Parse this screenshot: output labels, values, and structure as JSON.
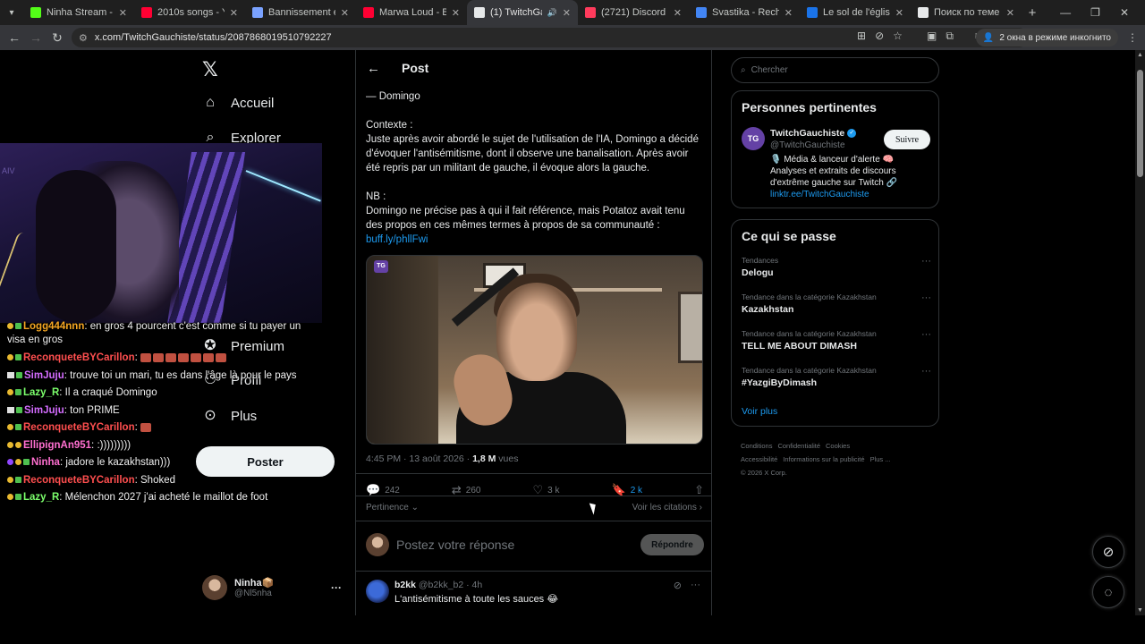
{
  "browser": {
    "tabs": [
      {
        "title": "Ninha Stream - Watc",
        "favicon_color": "#53fc18",
        "active": false
      },
      {
        "title": "2010s songs - YouTu",
        "favicon_color": "#ff0033",
        "active": false
      },
      {
        "title": "Bannissement et exp",
        "favicon_color": "#7aa2ff",
        "active": false
      },
      {
        "title": "Marwa Loud - Bad B",
        "favicon_color": "#ff0033",
        "active": false
      },
      {
        "title": "(1) TwitchGauchi",
        "favicon_color": "#e7e9ea",
        "active": true
      },
      {
        "title": "(2721) Discord | @Ne",
        "favicon_color": "#ff3b5c",
        "active": false
      },
      {
        "title": "Svastika - Recherche",
        "favicon_color": "#4285f4",
        "active": false
      },
      {
        "title": "Le sol de l'église de",
        "favicon_color": "#1a73e8",
        "active": false
      },
      {
        "title": "Поиск по теме «aze",
        "favicon_color": "#e7e9ea",
        "active": false
      }
    ],
    "url": "x.com/TwitchGauchiste/status/2087868019510792227",
    "incognito_label": "2 окна в режиме инкогнито"
  },
  "nav": {
    "items": [
      {
        "label": "Accueil",
        "icon": "home-icon"
      },
      {
        "label": "Explorer",
        "icon": "search-icon"
      },
      {
        "label": "Premium",
        "icon": "x-premium-icon"
      },
      {
        "label": "Profil",
        "icon": "profile-icon"
      },
      {
        "label": "Plus",
        "icon": "more-circle-icon"
      }
    ],
    "post_button": "Poster",
    "account": {
      "name": "Ninha📦",
      "handle": "@Nl5nha"
    }
  },
  "chat": [
    {
      "user": "Logg444nnn",
      "color": "#f5a623",
      "text": "en gros 4 pourcent c'est comme si tu payer un visa en gros"
    },
    {
      "user": "ReconqueteBYCarillon",
      "color": "#ff4f4f",
      "text": ""
    },
    {
      "user": "SimJuju",
      "color": "#d46cff",
      "text": "trouve toi un mari, tu es dans l'âge là pour le pays"
    },
    {
      "user": "Lazy_R",
      "color": "#7cff6c",
      "text": "Il a craqué Domingo"
    },
    {
      "user": "SimJuju",
      "color": "#d46cff",
      "text": "ton PRIME"
    },
    {
      "user": "ReconqueteBYCarillon",
      "color": "#ff4f4f",
      "text": ""
    },
    {
      "user": "EllipignAn951",
      "color": "#ff6fd0",
      "text": ":)))))))))"
    },
    {
      "user": "Ninha",
      "color": "#ff6fd0",
      "text": "jadore le kazakhstan)))"
    },
    {
      "user": "ReconqueteBYCarillon",
      "color": "#ff4f4f",
      "text": "Shoked"
    },
    {
      "user": "Lazy_R",
      "color": "#7cff6c",
      "text": "Mélenchon 2027 j'ai acheté le maillot de foot"
    }
  ],
  "post": {
    "header_title": "Post",
    "signature": "— Domingo",
    "context_label": "Contexte :",
    "context_text": "Juste après avoir abordé le sujet de l'utilisation de l'IA, Domingo a décidé d'évoquer l'antisémitisme, dont il observe une banalisation. Après avoir été repris par un militant de gauche, il évoque alors la gauche.",
    "nb_label": "NB :",
    "nb_text": "Domingo ne précise pas à qui il fait référence, mais Potatoz avait tenu des propos en ces mêmes termes à propos de sa communauté :",
    "link": "buff.ly/phllFwi",
    "media_badge": "TG",
    "time": "4:45 PM · 13 août 2026 · ",
    "views_count": "1,8 M",
    "views_label": " vues",
    "replies": "242",
    "reposts": "260",
    "likes": "3 k",
    "bookmarks": "2 k",
    "sort_label": "Pertinence",
    "quotes_label": "Voir les citations",
    "reply_placeholder": "Postez votre réponse",
    "reply_button": "Répondre"
  },
  "comment": {
    "name": "b2kk",
    "handle": "@b2kk_b2 · 4h",
    "text": "L'antisémitisme à toute les sauces 😂"
  },
  "sidebar": {
    "search_placeholder": "Chercher",
    "relevant_title": "Personnes pertinentes",
    "account": {
      "avatar": "TG",
      "name": "TwitchGauchiste",
      "handle": "@TwitchGauchiste",
      "follow": "Suivre",
      "bio": "🎙️ Média & lanceur d'alerte 🧠 Analyses et extraits de discours d'extrême gauche sur Twitch 🔗",
      "link": "linktr.ee/TwitchGauchiste"
    },
    "trends_title": "Ce qui se passe",
    "trends": [
      {
        "context": "Tendances",
        "name": "Delogu"
      },
      {
        "context": "Tendance dans la catégorie Kazakhstan",
        "name": "Kazakhstan"
      },
      {
        "context": "Tendance dans la catégorie Kazakhstan",
        "name": "TELL ME ABOUT DIMASH"
      },
      {
        "context": "Tendance dans la catégorie Kazakhstan",
        "name": "#YazgiByDimash"
      }
    ],
    "see_more": "Voir plus",
    "footer": [
      "Conditions",
      "Confidentialité",
      "Cookies",
      "Accessibilité",
      "Informations sur la publicité",
      "Plus ...",
      "© 2026 X Corp."
    ]
  }
}
